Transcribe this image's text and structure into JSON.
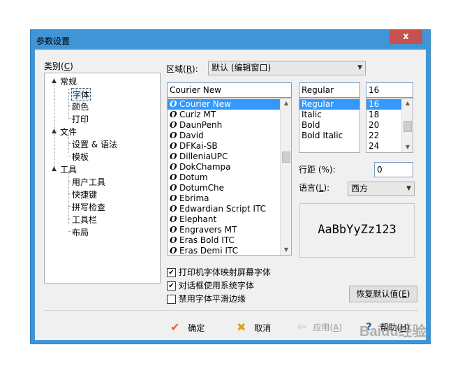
{
  "window": {
    "title": "参数设置",
    "close_label": "x"
  },
  "category": {
    "label": "类别(",
    "accel": "C",
    "label_end": ")",
    "tree": [
      {
        "label": "常规",
        "expand": "▲"
      },
      {
        "label": "字体",
        "selected": true
      },
      {
        "label": "颜色"
      },
      {
        "label": "打印"
      },
      {
        "label": "文件",
        "expand": "▲"
      },
      {
        "label": "设置 & 语法"
      },
      {
        "label": "模板"
      },
      {
        "label": "工具",
        "expand": "▲"
      },
      {
        "label": "用户工具"
      },
      {
        "label": "快捷键"
      },
      {
        "label": "拼写检查"
      },
      {
        "label": "工具栏"
      },
      {
        "label": "布局"
      }
    ]
  },
  "region": {
    "label": "区域(",
    "accel": "R",
    "label_end": "):",
    "value": "默认 (编辑窗口)"
  },
  "font": {
    "value": "Courier New",
    "items": [
      "Courier New",
      "Curlz MT",
      "DaunPenh",
      "David",
      "DFKai-SB",
      "DilleniaUPC",
      "DokChampa",
      "Dotum",
      "DotumChe",
      "Ebrima",
      "Edwardian Script ITC",
      "Elephant",
      "Engravers MT",
      "Eras Bold ITC",
      "Eras Demi ITC"
    ]
  },
  "style": {
    "value": "Regular",
    "items": [
      "Regular",
      "Italic",
      "Bold",
      "Bold Italic"
    ]
  },
  "size": {
    "value": "16",
    "items": [
      "16",
      "18",
      "20",
      "22",
      "24"
    ]
  },
  "line_spacing": {
    "label": "行距 (%):",
    "value": "0"
  },
  "language": {
    "label": "语言(",
    "accel": "L",
    "label_end": "):",
    "value": "西方"
  },
  "preview": {
    "text": "AaBbYyZz123"
  },
  "options": [
    {
      "label": "打印机字体映射屏幕字体",
      "checked": true
    },
    {
      "label": "对话框使用系统字体",
      "checked": true
    },
    {
      "label": "禁用字体平滑边缘",
      "checked": false
    }
  ],
  "restore_button": {
    "label": "恢复默认值(",
    "accel": "E",
    "label_end": ")"
  },
  "footer": {
    "ok": "确定",
    "cancel": "取消",
    "apply": "应用(",
    "apply_accel": "A",
    "apply_end": ")",
    "help": "帮助(",
    "help_accel": "H",
    "help_end": ")"
  },
  "watermark": "Baidu经验",
  "colors": {
    "title_bar": "#3f95d6",
    "close": "#c75050",
    "selection": "#3399ff",
    "ok_check": "#e8642c",
    "cancel_x": "#e0a21b",
    "help_icon": "#2a5db0"
  }
}
